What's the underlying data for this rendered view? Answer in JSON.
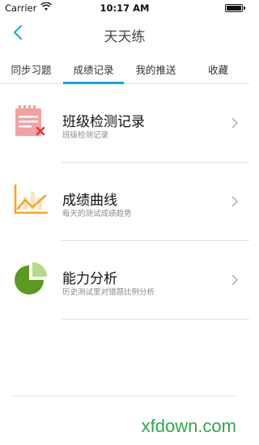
{
  "status_bar": {
    "carrier": "Carrier",
    "time": "10:17 AM"
  },
  "nav": {
    "title": "天天练",
    "back_icon": "chevron-left-icon"
  },
  "tabs": [
    {
      "label": "同步习题",
      "active": false
    },
    {
      "label": "成绩记录",
      "active": true
    },
    {
      "label": "我的推送",
      "active": false
    },
    {
      "label": "收藏",
      "active": false
    }
  ],
  "list": [
    {
      "label": "班级检测记录",
      "sub": "班级检测记录",
      "icon": "calendar-x-icon"
    },
    {
      "label": "成绩曲线",
      "sub": "每天的测试成绩趋势",
      "icon": "line-chart-icon"
    },
    {
      "label": "能力分析",
      "sub": "历史测试里对错题比例分析",
      "icon": "pie-chart-icon"
    }
  ],
  "watermark": "xfdown.com",
  "colors": {
    "accent": "#1aa3d8",
    "calendar_icon": "#f3a0a4",
    "chart_icon": "#f5a623",
    "pie_dark": "#5a9a1f",
    "pie_light": "#b6d98a",
    "watermark": "#2fa84a"
  }
}
